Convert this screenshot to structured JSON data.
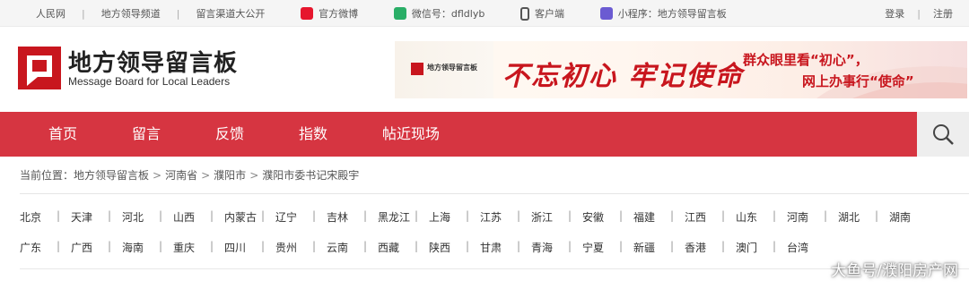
{
  "topbar": {
    "links": [
      {
        "label": "人民网",
        "icon": ""
      },
      {
        "label": "地方领导频道",
        "icon": ""
      },
      {
        "label": "留言渠道大公开",
        "icon": ""
      },
      {
        "label": "官方微博",
        "icon": "weibo-icon"
      },
      {
        "label": "微信号：dfldlyb",
        "icon": "wechat-icon"
      },
      {
        "label": "客户端",
        "icon": "phone-icon"
      },
      {
        "label": "小程序：地方领导留言板",
        "icon": "mini-program-icon"
      }
    ],
    "login": "登录",
    "register": "注册"
  },
  "header": {
    "title": "地方领导留言板",
    "subtitle": "Message Board for Local Leaders",
    "logo_color": "#c8161e"
  },
  "banner": {
    "mini_title": "地方领导留言板",
    "slogan_calligraphy": "不忘初心 牢记使命",
    "slogan_line1": "群众眼里看“初心”，",
    "slogan_line2": "网上办事行“使命”"
  },
  "nav": {
    "items": [
      "首页",
      "留言",
      "反馈",
      "指数",
      "帖近现场"
    ],
    "color": "#d63541"
  },
  "breadcrumb": {
    "prefix": "当前位置：",
    "items": [
      "地方领导留言板",
      "河南省",
      "濮阳市",
      "濮阳市委书记宋殿宇"
    ]
  },
  "regions": {
    "row1": [
      "北京",
      "天津",
      "河北",
      "山西",
      "内蒙古",
      "辽宁",
      "吉林",
      "黑龙江",
      "上海",
      "江苏",
      "浙江",
      "安徽",
      "福建",
      "江西",
      "山东",
      "河南",
      "湖北",
      "湖南"
    ],
    "row2": [
      "广东",
      "广西",
      "海南",
      "重庆",
      "四川",
      "贵州",
      "云南",
      "西藏",
      "陕西",
      "甘肃",
      "青海",
      "宁夏",
      "新疆",
      "香港",
      "澳门",
      "台湾"
    ]
  },
  "watermark": "大鱼号/濮阳房产网"
}
